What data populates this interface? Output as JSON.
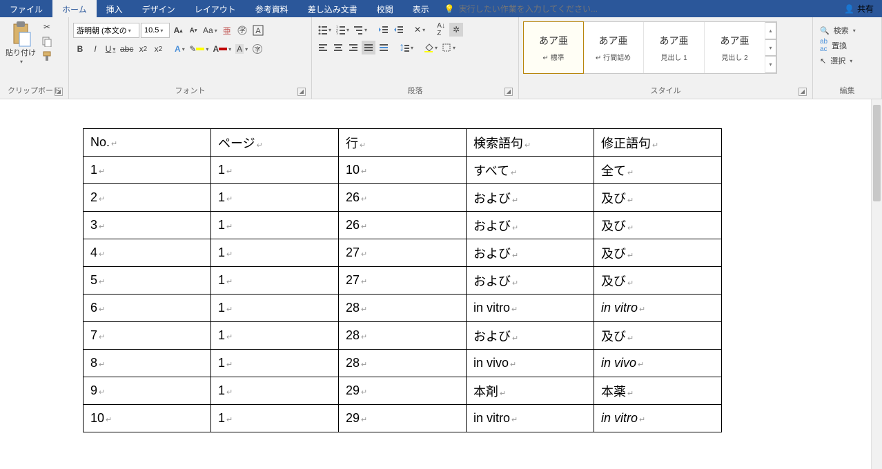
{
  "tabs": {
    "file": "ファイル",
    "home": "ホーム",
    "insert": "挿入",
    "design": "デザイン",
    "layout": "レイアウト",
    "references": "参考資料",
    "mailings": "差し込み文書",
    "review": "校閲",
    "view": "表示"
  },
  "tell_me": {
    "placeholder": "実行したい作業を入力してください..."
  },
  "share": "共有",
  "groups": {
    "clipboard": "クリップボード",
    "font": "フォント",
    "paragraph": "段落",
    "styles": "スタイル",
    "editing": "編集"
  },
  "clipboard": {
    "paste": "貼り付け"
  },
  "font": {
    "name": "游明朝 (本文の",
    "size": "10.5"
  },
  "styles": {
    "items": [
      {
        "sample": "あア亜",
        "label": "↵ 標準"
      },
      {
        "sample": "あア亜",
        "label": "↵ 行間詰め"
      },
      {
        "sample": "あア亜",
        "label": "見出し 1"
      },
      {
        "sample": "あア亜",
        "label": "見出し 2"
      }
    ]
  },
  "editing": {
    "find": "検索",
    "replace": "置換",
    "select": "選択"
  },
  "table": {
    "headers": [
      "No.",
      "ページ",
      "行",
      "検索語句",
      "修正語句"
    ],
    "rows": [
      [
        "1",
        "1",
        "10",
        "すべて",
        "全て"
      ],
      [
        "2",
        "1",
        "26",
        "および",
        "及び"
      ],
      [
        "3",
        "1",
        "26",
        "および",
        "及び"
      ],
      [
        "4",
        "1",
        "27",
        "および",
        "及び"
      ],
      [
        "5",
        "1",
        "27",
        "および",
        "及び"
      ],
      [
        "6",
        "1",
        "28",
        "in vitro",
        "in vitro"
      ],
      [
        "7",
        "1",
        "28",
        "および",
        "及び"
      ],
      [
        "8",
        "1",
        "28",
        "in vivo",
        "in vivo"
      ],
      [
        "9",
        "1",
        "29",
        "本剤",
        "本薬"
      ],
      [
        "10",
        "1",
        "29",
        "in vitro",
        "in vitro"
      ]
    ],
    "italic_rows": [
      5,
      7,
      9
    ]
  }
}
